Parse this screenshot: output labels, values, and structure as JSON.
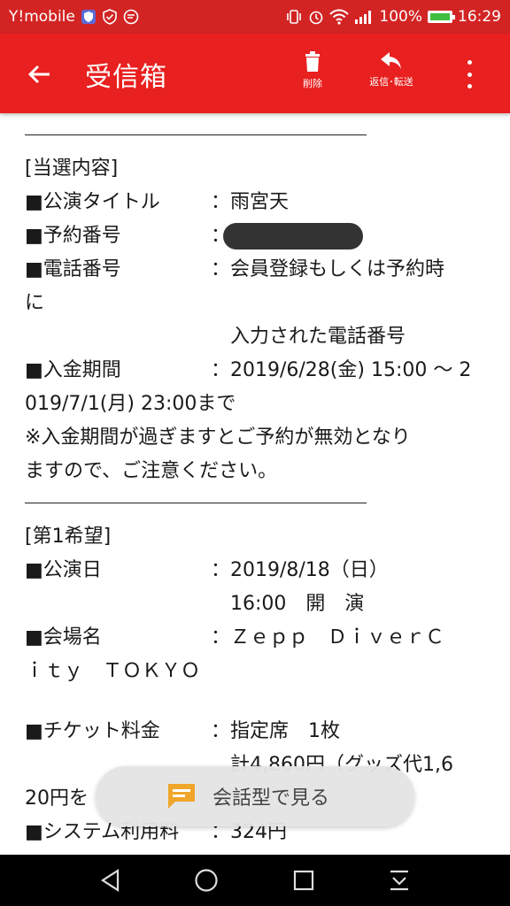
{
  "status_bar": {
    "carrier": "Y!mobile",
    "battery": "100%",
    "time": "16:29"
  },
  "app_bar": {
    "title": "受信箱",
    "delete_label": "削除",
    "reply_label": "返信･転送"
  },
  "email": {
    "section1_header": "[当選内容]",
    "rows1": [
      {
        "label": "■公演タイトル",
        "value": "雨宮天"
      },
      {
        "label": "■予約番号",
        "value": ""
      },
      {
        "label": "■電話番号",
        "value": "会員登録もしくは予約時"
      }
    ],
    "phone_wrap": "に",
    "phone_cont": "入力された電話番号",
    "payment_label": "■入金期間",
    "payment_value": "2019/6/28(金) 15:00 ～ 2",
    "payment_wrap": "019/7/1(月) 23:00まで",
    "note_line1": "※入金期間が過ぎますとご予約が無効となり",
    "note_line2": "ますので、ご注意ください。",
    "section2_header": "[第1希望]",
    "date_label": "■公演日",
    "date_value": "2019/8/18（日）",
    "time_value": "16:00　開　演",
    "venue_label": "■会場名",
    "venue_value": "Ｚｅｐｐ　ＤｉｖｅｒＣ",
    "venue_wrap": "ｉｔｙ　ＴＯＫＹＯ",
    "ticket_label": "■チケット料金",
    "ticket_value": "指定席　1枚",
    "ticket_total": "計4,860円（グッズ代1,6",
    "ticket_wrap": "20円を",
    "system_label": "■システム利用料",
    "system_value": "324円"
  },
  "float_button": {
    "label": "会話型で見る"
  },
  "colors": {
    "status_bar": "#d32424",
    "app_bar": "#e8201f",
    "chat_icon": "#f0a62a"
  }
}
